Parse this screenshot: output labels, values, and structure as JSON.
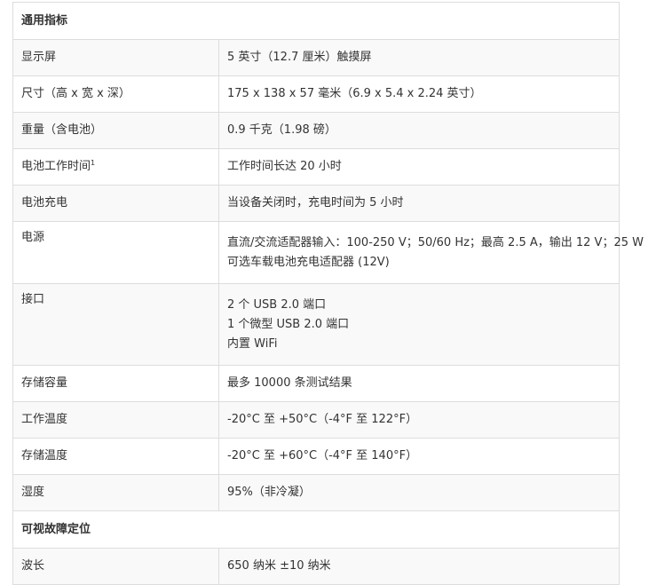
{
  "sections": [
    {
      "title": "通用指标",
      "rows": [
        {
          "label": "显示屏",
          "values": [
            "5 英寸（12.7 厘米）触摸屏"
          ]
        },
        {
          "label": "尺寸（高 x 宽 x 深）",
          "values": [
            "175 x 138 x 57 毫米（6.9 x 5.4 x 2.24 英寸）"
          ]
        },
        {
          "label": "重量（含电池）",
          "values": [
            "0.9 千克（1.98 磅）"
          ]
        },
        {
          "label": "电池工作时间",
          "label_sup": "1",
          "values": [
            "工作时间长达 20 小时"
          ]
        },
        {
          "label": "电池充电",
          "values": [
            "当设备关闭时，充电时间为 5 小时"
          ]
        },
        {
          "label": "电源",
          "values": [
            "直流/交流适配器输入：100-250 V；50/60 Hz；最高 2.5 A，输出 12 V；25 W",
            "可选车载电池充电适配器 (12V)"
          ]
        },
        {
          "label": "接口",
          "values": [
            "2 个 USB 2.0 端口",
            "1 个微型 USB 2.0 端口",
            "内置 WiFi"
          ]
        },
        {
          "label": "存储容量",
          "values": [
            "最多 10000 条测试结果"
          ]
        },
        {
          "label": "工作温度",
          "values": [
            "-20°C 至 +50°C（-4°F 至 122°F）"
          ]
        },
        {
          "label": "存储温度",
          "values": [
            "-20°C 至 +60°C（-4°F 至 140°F）"
          ]
        },
        {
          "label": "湿度",
          "values": [
            "95%（非冷凝）"
          ]
        }
      ]
    },
    {
      "title": "可视故障定位",
      "rows": [
        {
          "label": "波长",
          "values": [
            "650 纳米 ±10 纳米"
          ]
        }
      ]
    }
  ]
}
